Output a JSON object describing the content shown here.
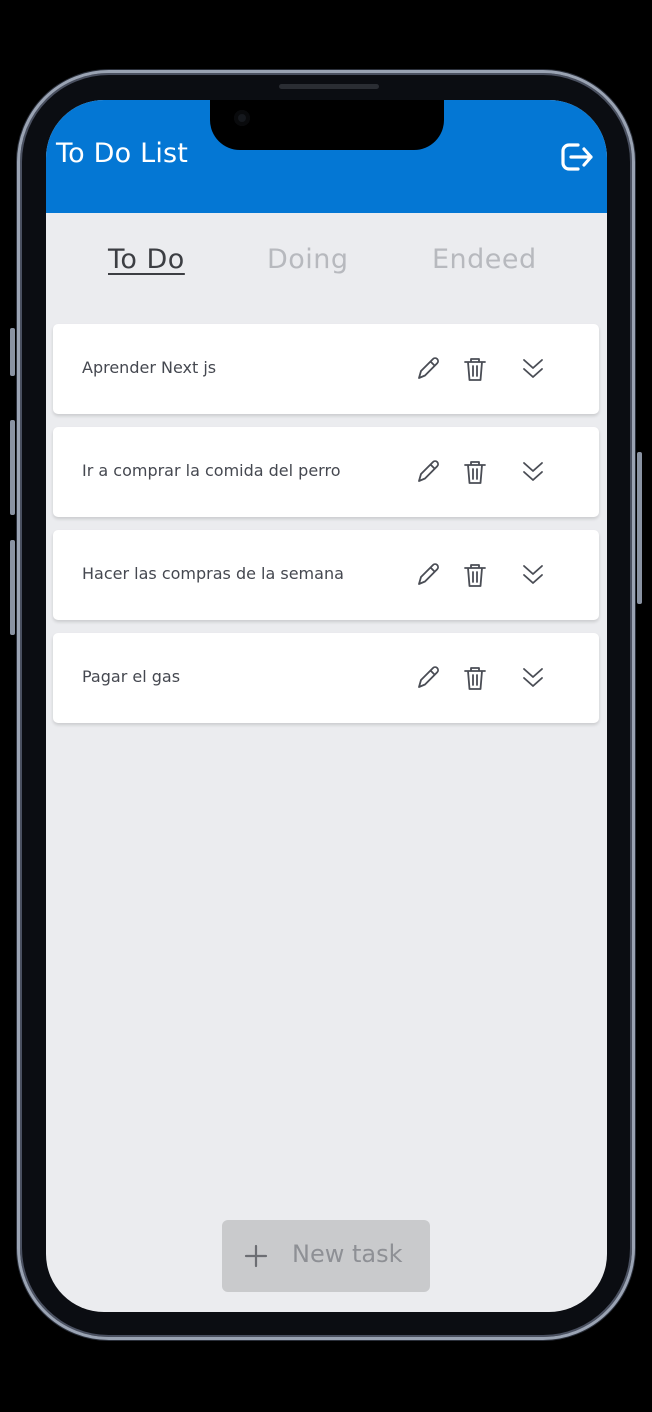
{
  "header": {
    "title": "To Do List",
    "color": "#0477d4",
    "logout_icon": "logout-icon"
  },
  "tabs": [
    {
      "label": "To Do",
      "active": true
    },
    {
      "label": "Doing",
      "active": false
    },
    {
      "label": "Endeed",
      "active": false
    }
  ],
  "tasks": [
    {
      "text": "Aprender Next js"
    },
    {
      "text": "Ir a comprar la comida del perro"
    },
    {
      "text": "Hacer las compras de la semana"
    },
    {
      "text": "Pagar el gas"
    }
  ],
  "task_actions": {
    "edit_icon": "pencil-icon",
    "delete_icon": "trash-icon",
    "move_icon": "double-chevron-down-icon"
  },
  "footer": {
    "new_task_label": "New task",
    "new_task_icon": "plus-icon"
  }
}
